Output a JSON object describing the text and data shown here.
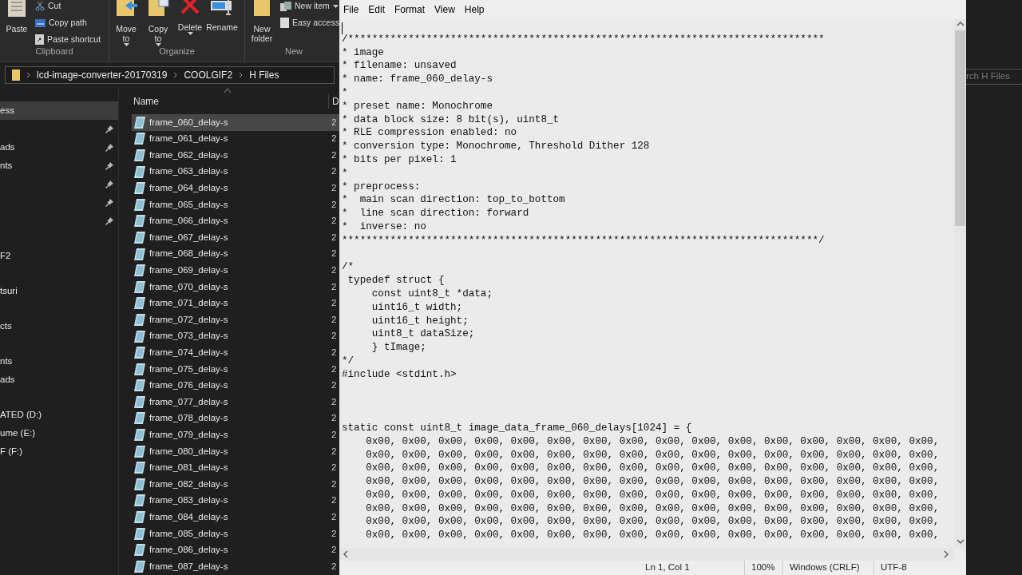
{
  "ribbon": {
    "groups": [
      {
        "label": "Clipboard",
        "large": [
          {
            "label": "Paste",
            "dropdown": false
          }
        ],
        "small": [
          {
            "label": "Cut",
            "dropdown": false
          },
          {
            "label": "Copy path",
            "dropdown": false
          },
          {
            "label": "Paste shortcut",
            "dropdown": false
          }
        ]
      },
      {
        "label": "Organize",
        "large": [
          {
            "label": "Move to",
            "dropdown": true
          },
          {
            "label": "Copy to",
            "dropdown": true
          },
          {
            "label": "Delete",
            "dropdown": true
          },
          {
            "label": "Rename",
            "dropdown": false
          }
        ]
      },
      {
        "label": "New",
        "large": [
          {
            "label": "New folder",
            "dropdown": false
          }
        ],
        "small": [
          {
            "label": "New item",
            "dropdown": true
          },
          {
            "label": "Easy access",
            "dropdown": false
          }
        ]
      }
    ]
  },
  "address": {
    "crumbs": [
      "lcd-image-converter-20170319",
      "COOLGIF2",
      "H Files"
    ]
  },
  "search": {
    "placeholder": "rch H Files"
  },
  "nav": {
    "groups": [
      [
        {
          "label": "ess",
          "pinned": false,
          "selected": true
        },
        {
          "pinned": true,
          "selected": false
        },
        {
          "label": "ads",
          "pinned": true,
          "selected": false
        },
        {
          "label": "nts",
          "pinned": true,
          "selected": false
        },
        {
          "pinned": true,
          "selected": false
        },
        {
          "pinned": true,
          "selected": false
        },
        {
          "pinned": true,
          "selected": false
        }
      ],
      [
        {
          "label": "F2",
          "pinned": false,
          "selected": false
        }
      ],
      [
        {
          "label": "tsuri",
          "pinned": false,
          "selected": false
        }
      ],
      [
        {
          "label": "cts",
          "pinned": false,
          "selected": false
        }
      ],
      [
        {
          "label": "nts",
          "pinned": false,
          "selected": false
        },
        {
          "label": "ads",
          "pinned": false,
          "selected": false
        }
      ],
      [
        {
          "label": "ATED (D:)",
          "pinned": false,
          "selected": false
        },
        {
          "label": "ume (E:)",
          "pinned": false,
          "selected": false
        },
        {
          "label": "F (F:)",
          "pinned": false,
          "selected": false
        }
      ]
    ]
  },
  "files": {
    "columns": [
      "Name",
      "D"
    ],
    "rows": [
      {
        "name": "frame_060_delay-s",
        "column_2": "2",
        "selected": true
      },
      {
        "name": "frame_061_delay-s",
        "column_2": "2",
        "selected": false
      },
      {
        "name": "frame_062_delay-s",
        "column_2": "2",
        "selected": false
      },
      {
        "name": "frame_063_delay-s",
        "column_2": "2",
        "selected": false
      },
      {
        "name": "frame_064_delay-s",
        "column_2": "2",
        "selected": false
      },
      {
        "name": "frame_065_delay-s",
        "column_2": "2",
        "selected": false
      },
      {
        "name": "frame_066_delay-s",
        "column_2": "2",
        "selected": false
      },
      {
        "name": "frame_067_delay-s",
        "column_2": "2",
        "selected": false
      },
      {
        "name": "frame_068_delay-s",
        "column_2": "2",
        "selected": false
      },
      {
        "name": "frame_069_delay-s",
        "column_2": "2",
        "selected": false
      },
      {
        "name": "frame_070_delay-s",
        "column_2": "2",
        "selected": false
      },
      {
        "name": "frame_071_delay-s",
        "column_2": "2",
        "selected": false
      },
      {
        "name": "frame_072_delay-s",
        "column_2": "2",
        "selected": false
      },
      {
        "name": "frame_073_delay-s",
        "column_2": "2",
        "selected": false
      },
      {
        "name": "frame_074_delay-s",
        "column_2": "2",
        "selected": false
      },
      {
        "name": "frame_075_delay-s",
        "column_2": "2",
        "selected": false
      },
      {
        "name": "frame_076_delay-s",
        "column_2": "2",
        "selected": false
      },
      {
        "name": "frame_077_delay-s",
        "column_2": "2",
        "selected": false
      },
      {
        "name": "frame_078_delay-s",
        "column_2": "2",
        "selected": false
      },
      {
        "name": "frame_079_delay-s",
        "column_2": "2",
        "selected": false
      },
      {
        "name": "frame_080_delay-s",
        "column_2": "2",
        "selected": false
      },
      {
        "name": "frame_081_delay-s",
        "column_2": "2",
        "selected": false
      },
      {
        "name": "frame_082_delay-s",
        "column_2": "2",
        "selected": false
      },
      {
        "name": "frame_083_delay-s",
        "column_2": "2",
        "selected": false
      },
      {
        "name": "frame_084_delay-s",
        "column_2": "2",
        "selected": false
      },
      {
        "name": "frame_085_delay-s",
        "column_2": "2",
        "selected": false
      },
      {
        "name": "frame_086_delay-s",
        "column_2": "2",
        "selected": false
      },
      {
        "name": "frame_087_delay-s",
        "column_2": "2",
        "selected": false
      }
    ]
  },
  "notepad": {
    "menu": [
      "File",
      "Edit",
      "Format",
      "View",
      "Help"
    ],
    "content": "\n/*******************************************************************************\n* image\n* filename: unsaved\n* name: frame_060_delay-s\n*\n* preset name: Monochrome\n* data block size: 8 bit(s), uint8_t\n* RLE compression enabled: no\n* conversion type: Monochrome, Threshold Dither 128\n* bits per pixel: 1\n*\n* preprocess:\n*  main scan direction: top_to_bottom\n*  line scan direction: forward\n*  inverse: no\n*******************************************************************************/\n\n/*\n typedef struct {\n     const uint8_t *data;\n     uint16_t width;\n     uint16_t height;\n     uint8_t dataSize;\n     } tImage;\n*/\n#include <stdint.h>\n\n\n\nstatic const uint8_t image_data_frame_060_delays[1024] = {\n    0x00, 0x00, 0x00, 0x00, 0x00, 0x00, 0x00, 0x00, 0x00, 0x00, 0x00, 0x00, 0x00, 0x00, 0x00, 0x00,\n    0x00, 0x00, 0x00, 0x00, 0x00, 0x00, 0x00, 0x00, 0x00, 0x00, 0x00, 0x00, 0x00, 0x00, 0x00, 0x00,\n    0x00, 0x00, 0x00, 0x00, 0x00, 0x00, 0x00, 0x00, 0x00, 0x00, 0x00, 0x00, 0x00, 0x00, 0x00, 0x00,\n    0x00, 0x00, 0x00, 0x00, 0x00, 0x00, 0x00, 0x00, 0x00, 0x00, 0x00, 0x00, 0x00, 0x00, 0x00, 0x00,\n    0x00, 0x00, 0x00, 0x00, 0x00, 0x00, 0x00, 0x00, 0x00, 0x00, 0x00, 0x00, 0x00, 0x00, 0x00, 0x00,\n    0x00, 0x00, 0x00, 0x00, 0x00, 0x00, 0x00, 0x00, 0x00, 0x00, 0x00, 0x00, 0x00, 0x00, 0x00, 0x00,\n    0x00, 0x00, 0x00, 0x00, 0x00, 0x00, 0x00, 0x00, 0x00, 0x00, 0x00, 0x00, 0x00, 0x00, 0x00, 0x00,\n    0x00, 0x00, 0x00, 0x00, 0x00, 0x00, 0x00, 0x00, 0x00, 0x00, 0x00, 0x00, 0x00, 0x00, 0x00, 0x00,",
    "status": [
      "Ln 1, Col 1",
      "100%",
      "Windows (CRLF)",
      "UTF-8"
    ]
  }
}
